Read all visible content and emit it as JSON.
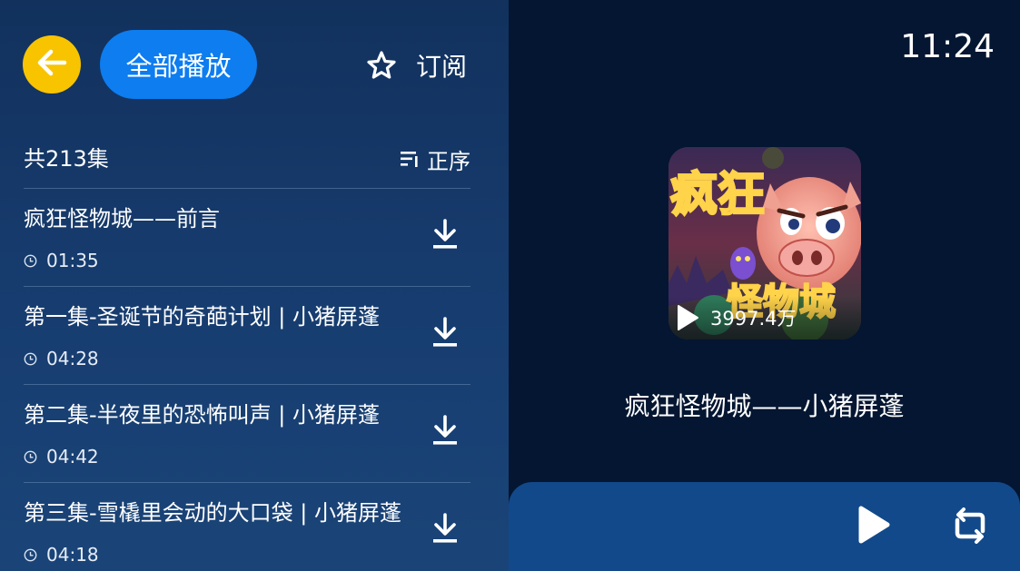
{
  "header": {
    "play_all_label": "全部播放",
    "subscribe_label": "订阅",
    "back_icon": "arrow-left-icon",
    "subscribe_icon": "star-outline-icon"
  },
  "list": {
    "count_label": "共213集",
    "sort_label": "正序",
    "sort_icon": "sort-list-icon",
    "episodes": [
      {
        "title": "疯狂怪物城——前言",
        "duration": "01:35"
      },
      {
        "title": "第一集-圣诞节的奇葩计划 | 小猪屏蓬",
        "duration": "04:28"
      },
      {
        "title": "第二集-半夜里的恐怖叫声 | 小猪屏蓬",
        "duration": "04:42"
      },
      {
        "title": "第三集-雪橇里会动的大口袋 | 小猪屏蓬",
        "duration": "04:18"
      }
    ]
  },
  "status": {
    "time": "11:24"
  },
  "album": {
    "play_count": "3997.4万",
    "title": "疯狂怪物城——小猪屏蓬",
    "cover_text_top": "疯狂",
    "cover_text_bottom": "怪物城"
  },
  "player": {
    "play_icon": "play-icon",
    "loop_icon": "loop-icon"
  },
  "colors": {
    "accent_yellow": "#f8c400",
    "accent_blue": "#0d7df0",
    "left_bg": "#173d70",
    "right_bg": "#041631",
    "player_bar": "#12498a"
  }
}
